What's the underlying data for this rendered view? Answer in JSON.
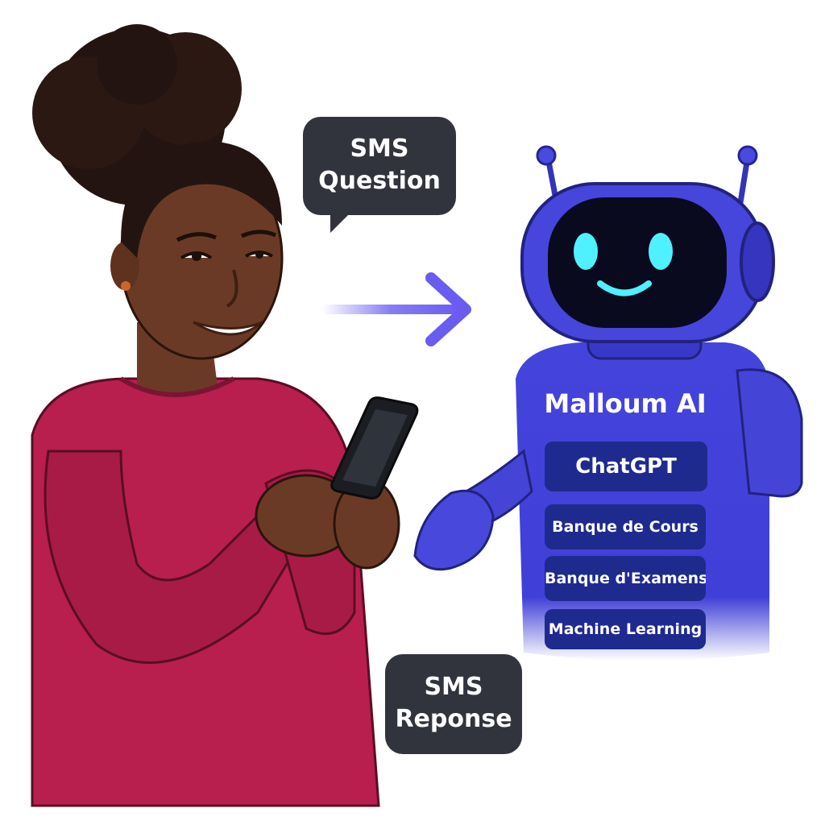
{
  "bubbles": {
    "question": [
      "SMS",
      "Question"
    ],
    "reponse": [
      "SMS",
      "Reponse"
    ]
  },
  "robot": {
    "title": "Malloum AI",
    "modules": [
      "ChatGPT",
      "Banque de Cours",
      "Banque d'Examens",
      "Machine Learning"
    ]
  },
  "icons": {
    "arrow": "arrow-right-icon",
    "phone": "smartphone-icon"
  },
  "colors": {
    "bubble": "#31343c",
    "robot_body": "#3f3fd6",
    "robot_panel": "#1f2a8f",
    "robot_eyes": "#4ff0ff",
    "arrow": "#6a5cf0",
    "shirt": "#b81e4e",
    "skin": "#6b3a26"
  }
}
